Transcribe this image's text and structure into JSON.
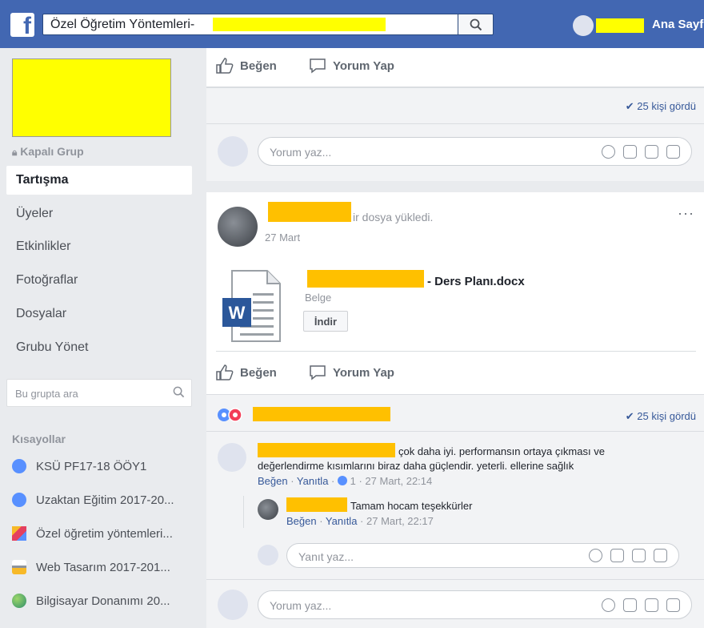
{
  "topbar": {
    "search_value": "Özel Öğretim Yöntemleri-",
    "home_label": "Ana Sayf"
  },
  "sidebar": {
    "group_type": "Kapalı Grup",
    "items": [
      {
        "label": "Tartışma"
      },
      {
        "label": "Üyeler"
      },
      {
        "label": "Etkinlikler"
      },
      {
        "label": "Fotoğraflar"
      },
      {
        "label": "Dosyalar"
      },
      {
        "label": "Grubu Yönet"
      }
    ],
    "search_placeholder": "Bu grupta ara",
    "shortcuts_title": "Kısayollar",
    "shortcuts": [
      {
        "label": "KSÜ PF17-18 ÖÖY1"
      },
      {
        "label": "Uzaktan Eğitim 2017-20..."
      },
      {
        "label": "Özel öğretim yöntemleri..."
      },
      {
        "label": "Web Tasarım 2017-201..."
      },
      {
        "label": "Bilgisayar Donanımı 20..."
      }
    ]
  },
  "post1": {
    "like": "Beğen",
    "comment": "Yorum Yap",
    "seen": "25 kişi gördü",
    "comment_placeholder": "Yorum yaz..."
  },
  "post2": {
    "action_suffix": "ir dosya yükledi.",
    "date": "27 Mart",
    "file_name_suffix": "- Ders Planı.docx",
    "file_type": "Belge",
    "download": "İndir",
    "like": "Beğen",
    "comment": "Yorum Yap",
    "seen": "25 kişi gördü",
    "comment1": {
      "line1": "çok daha iyi. performansın ortaya çıkması ve",
      "line2": "değerlendirme kısımlarını biraz daha güçlendir. yeterli. ellerine sağlık",
      "like": "Beğen",
      "reply": "Yanıtla",
      "reaction_count": "1",
      "time": "27 Mart, 22:14"
    },
    "reply1": {
      "text": "Tamam hocam teşekkürler",
      "like": "Beğen",
      "reply": "Yanıtla",
      "time": "27 Mart, 22:17"
    },
    "reply_placeholder": "Yanıt yaz...",
    "comment_placeholder": "Yorum yaz..."
  },
  "colors": {
    "brand": "#4267b2",
    "link": "#365899",
    "redaction_yellow": "#ffff00",
    "redaction_orange": "#ffc000"
  }
}
